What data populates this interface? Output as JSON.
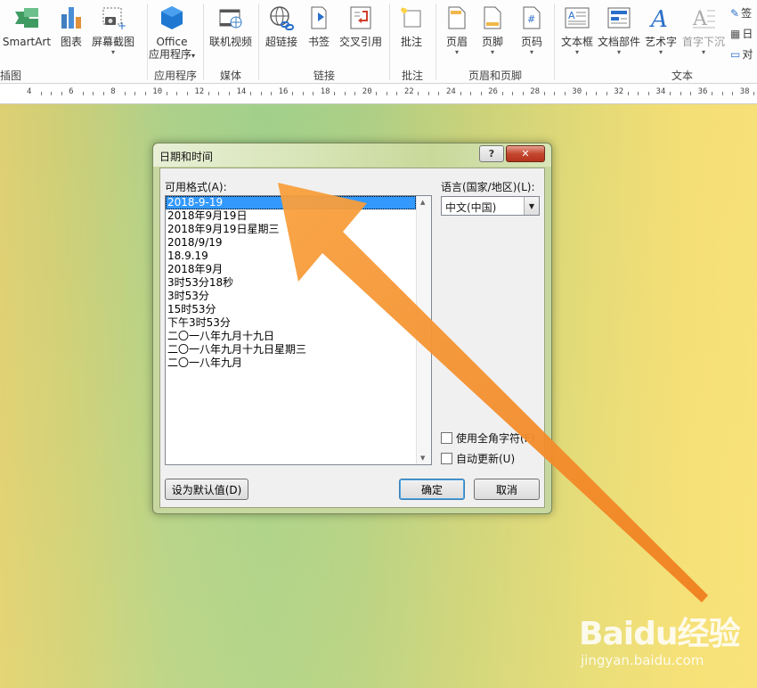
{
  "ribbon": {
    "buttons": {
      "smartart": "SmartArt",
      "chart": "图表",
      "screenshot": "屏幕截图",
      "office_apps_1": "Office",
      "office_apps_2": "应用程序",
      "online_video": "联机视频",
      "hyperlink": "超链接",
      "bookmark": "书签",
      "cross_ref": "交叉引用",
      "comment": "批注",
      "header": "页眉",
      "footer": "页脚",
      "page_number": "页码",
      "textbox": "文本框",
      "quick_parts": "文档部件",
      "wordart": "艺术字",
      "dropcap": "首字下沉",
      "signature": "签",
      "datetime": "日",
      "object": "对"
    },
    "groups": {
      "illustrations": "插图",
      "apps": "应用程序",
      "media": "媒体",
      "links": "链接",
      "comments": "批注",
      "header_footer": "页眉和页脚",
      "text": "文本"
    }
  },
  "ruler": {
    "marks": [
      "4",
      "6",
      "8",
      "10",
      "12",
      "14",
      "16",
      "18",
      "20",
      "22",
      "24",
      "26",
      "28",
      "30",
      "32",
      "34",
      "36",
      "38"
    ]
  },
  "dialog": {
    "title": "日期和时间",
    "help_glyph": "?",
    "close_glyph": "✕",
    "formats_label": "可用格式(A):",
    "formats": [
      "2018-9-19",
      "2018年9月19日",
      "2018年9月19日星期三",
      "2018/9/19",
      "18.9.19",
      "2018年9月",
      "3时53分18秒",
      "3时53分",
      "15时53分",
      "下午3时53分",
      "二〇一八年九月十九日",
      "二〇一八年九月十九日星期三",
      "二〇一八年九月"
    ],
    "selected_index": 0,
    "language_label": "语言(国家/地区)(L):",
    "language_value": "中文(中国)",
    "fullwidth_label": "使用全角字符(F)",
    "fullwidth_checked": false,
    "autoupdate_label": "自动更新(U)",
    "autoupdate_checked": false,
    "set_default_label": "设为默认值(D)",
    "ok_label": "确定",
    "cancel_label": "取消"
  },
  "watermark": {
    "brand": "Baidu经验",
    "url": "jingyan.baidu.com"
  },
  "colors": {
    "arrow": "#f07f1f",
    "selection": "#3399ff",
    "close_button": "#c4472f"
  }
}
